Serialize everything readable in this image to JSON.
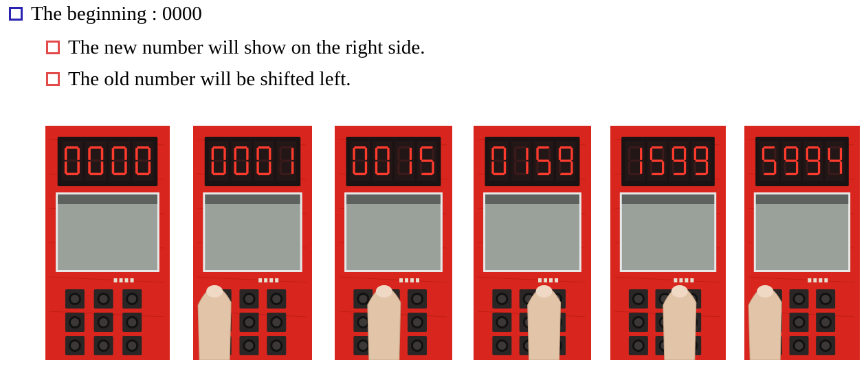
{
  "bullets": [
    {
      "text": "The beginning : 0000",
      "level": 1,
      "color": "#2a22b3"
    },
    {
      "text": "The new number will show on the right side.",
      "level": 2,
      "color": "#e34a4a"
    },
    {
      "text": "The old number will be shifted left.",
      "level": 2,
      "color": "#e34a4a"
    }
  ],
  "photos": [
    {
      "display": "0000",
      "finger": "none"
    },
    {
      "display": "0001",
      "finger": "left"
    },
    {
      "display": "0015",
      "finger": "center"
    },
    {
      "display": "0159",
      "finger": "right"
    },
    {
      "display": "1599",
      "finger": "right"
    },
    {
      "display": "5994",
      "finger": "left"
    }
  ],
  "colors": {
    "segment_on": "#ff3b2e",
    "segment_off": "#3a1a1a",
    "pcb": "#d8261e",
    "lcd": "#9aa19a"
  }
}
